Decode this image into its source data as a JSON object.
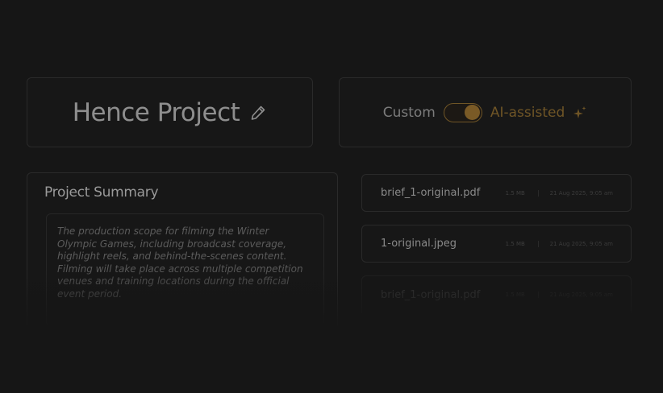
{
  "project": {
    "title": "Hence Project",
    "edit_icon": "pencil-icon"
  },
  "mode": {
    "custom_label": "Custom",
    "ai_label": "AI-assisted",
    "ai_icon": "sparkle-icon",
    "selected": "AI-assisted",
    "accent_color": "#7a5a26"
  },
  "summary": {
    "title": "Project Summary",
    "text": "The production scope for filming the Winter Olympic Games, including broadcast coverage, highlight reels, and behind-the-scenes content. Filming will take place across multiple competition venues and training locations during the official event period."
  },
  "files": [
    {
      "name": "brief_1-original.pdf",
      "size": "1.5 MB",
      "date": "21 Aug 2025, 9:05 am"
    },
    {
      "name": "1-original.jpeg",
      "size": "1.5 MB",
      "date": "21 Aug 2025, 9:05 am"
    },
    {
      "name": "brief_1-original.pdf",
      "size": "1.5 MB",
      "date": "21 Aug 2025, 9:05 am"
    }
  ]
}
